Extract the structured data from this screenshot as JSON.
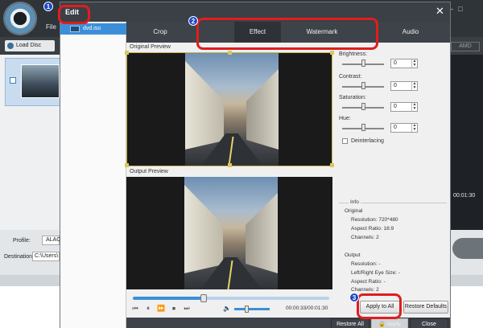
{
  "background_app": {
    "menu_file": "File",
    "load_disc_label": "Load Disc",
    "amd_label": "AMD",
    "time_readout": "00:01:30",
    "profile_label": "Profile:",
    "profile_value": "ALAC",
    "destination_label": "Destination:",
    "destination_value": "C:\\Users\\"
  },
  "dialog": {
    "title": "Edit",
    "close_glyph": "✕",
    "file_item": "dvd.iso",
    "tabs": [
      {
        "label": "Crop",
        "active": false
      },
      {
        "label": "Effect",
        "active": true
      },
      {
        "label": "Watermark",
        "active": false
      },
      {
        "label": "Audio",
        "active": false
      }
    ],
    "original_preview_label": "Original Preview",
    "output_preview_label": "Output Preview",
    "adjustments": [
      {
        "label": "Brightness:",
        "value": "0"
      },
      {
        "label": "Contrast:",
        "value": "0"
      },
      {
        "label": "Saturation:",
        "value": "0"
      },
      {
        "label": "Hue:",
        "value": "0"
      }
    ],
    "deinterlacing_label": "Deinterlacing",
    "deinterlacing_checked": false,
    "info": {
      "heading": "Info",
      "original_heading": "Original",
      "original_lines": [
        "Resolution: 720*480",
        "Aspect Ratio: 16:9",
        "Channels: 2"
      ],
      "output_heading": "Output",
      "output_lines": [
        "Resolution: -",
        "Left/Right Eye Size: -",
        "Aspect Ratio: -",
        "Channels: 2"
      ]
    },
    "player": {
      "time": "00:00:33/00:01:30",
      "progress_fraction": 0.36,
      "volume_fraction": 0.35
    },
    "buttons": {
      "apply_to_all": "Apply to All",
      "restore_defaults": "Restore Defaults",
      "restore_all": "Restore All",
      "apply": "Apply",
      "close": "Close"
    }
  },
  "annotations": [
    "1",
    "2",
    "3"
  ],
  "colors": {
    "annotation_red": "#e01d1d",
    "annotation_badge_blue": "#1d47c9",
    "selection_blue": "#3b8fd9"
  }
}
